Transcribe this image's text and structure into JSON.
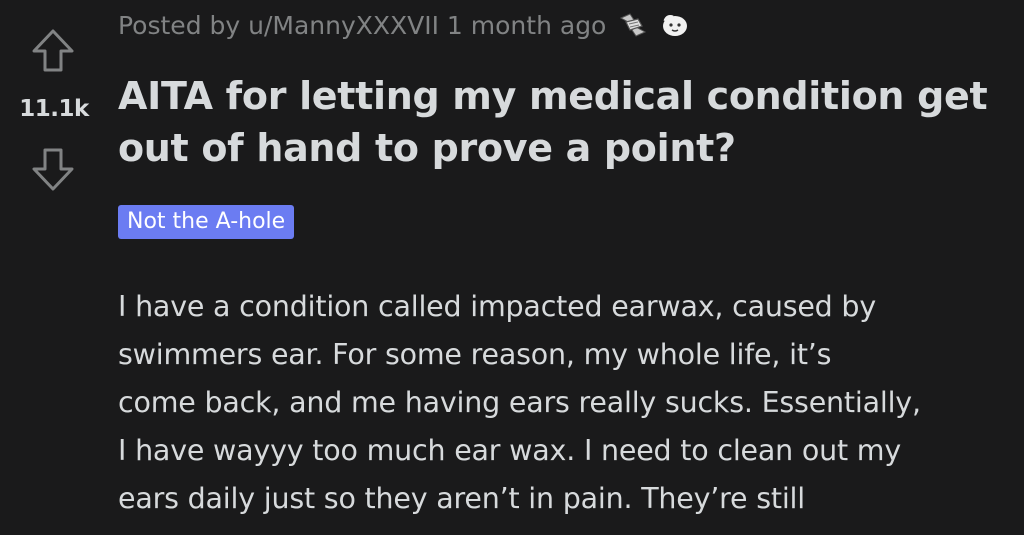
{
  "post": {
    "meta": "Posted by u/MannyXXXVII 1 month ago",
    "awards": [
      "hands-clasp-award-icon",
      "face-award-icon"
    ],
    "score": "11.1k",
    "title_lines": [
      "AITA for letting my medical condition get",
      "out of hand to prove a point?"
    ],
    "flair": "Not the A-hole",
    "body_lines": [
      "I have a condition called impacted earwax, caused by",
      "swimmers ear. For some reason, my whole life, it’s",
      "come back, and me having ears really sucks. Essentially,",
      "I have wayyy too much ear wax. I need to clean out my",
      "ears daily just so they aren’t in pain. They’re still"
    ]
  },
  "colors": {
    "background": "#1a1a1b",
    "text": "#d7dadc",
    "muted": "#818384",
    "flair_bg": "#6b7cf2"
  }
}
